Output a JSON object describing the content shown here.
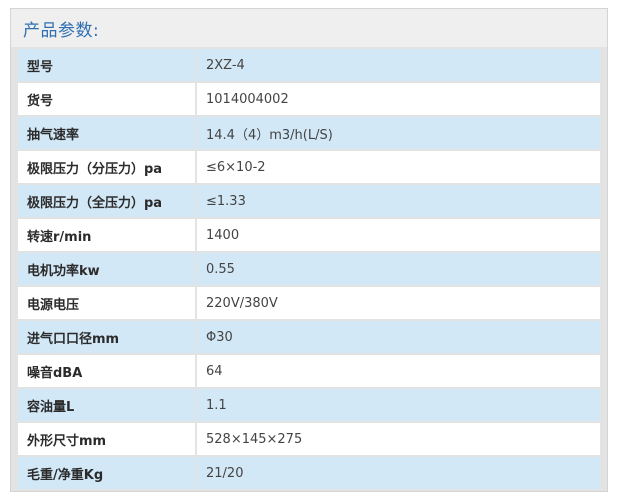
{
  "header": {
    "title": "产品参数:"
  },
  "rows": [
    {
      "label": "型号",
      "value": "2XZ-4"
    },
    {
      "label": "货号",
      "value": "1014004002"
    },
    {
      "label": "抽气速率",
      "value": "14.4（4）m3/h(L/S)"
    },
    {
      "label": "极限压力（分压力）pa",
      "value": "≤6×10-2"
    },
    {
      "label": "极限压力（全压力）pa",
      "value": "≤1.33"
    },
    {
      "label": "转速r/min",
      "value": "1400"
    },
    {
      "label": "电机功率kw",
      "value": "0.55"
    },
    {
      "label": "电源电压",
      "value": "220V/380V"
    },
    {
      "label": "进气口口径mm",
      "value": "Φ30"
    },
    {
      "label": "噪音dBA",
      "value": "64"
    },
    {
      "label": "容油量L",
      "value": "1.1"
    },
    {
      "label": "外形尺寸mm",
      "value": "528×145×275"
    },
    {
      "label": "毛重/净重Kg",
      "value": "21/20"
    }
  ]
}
